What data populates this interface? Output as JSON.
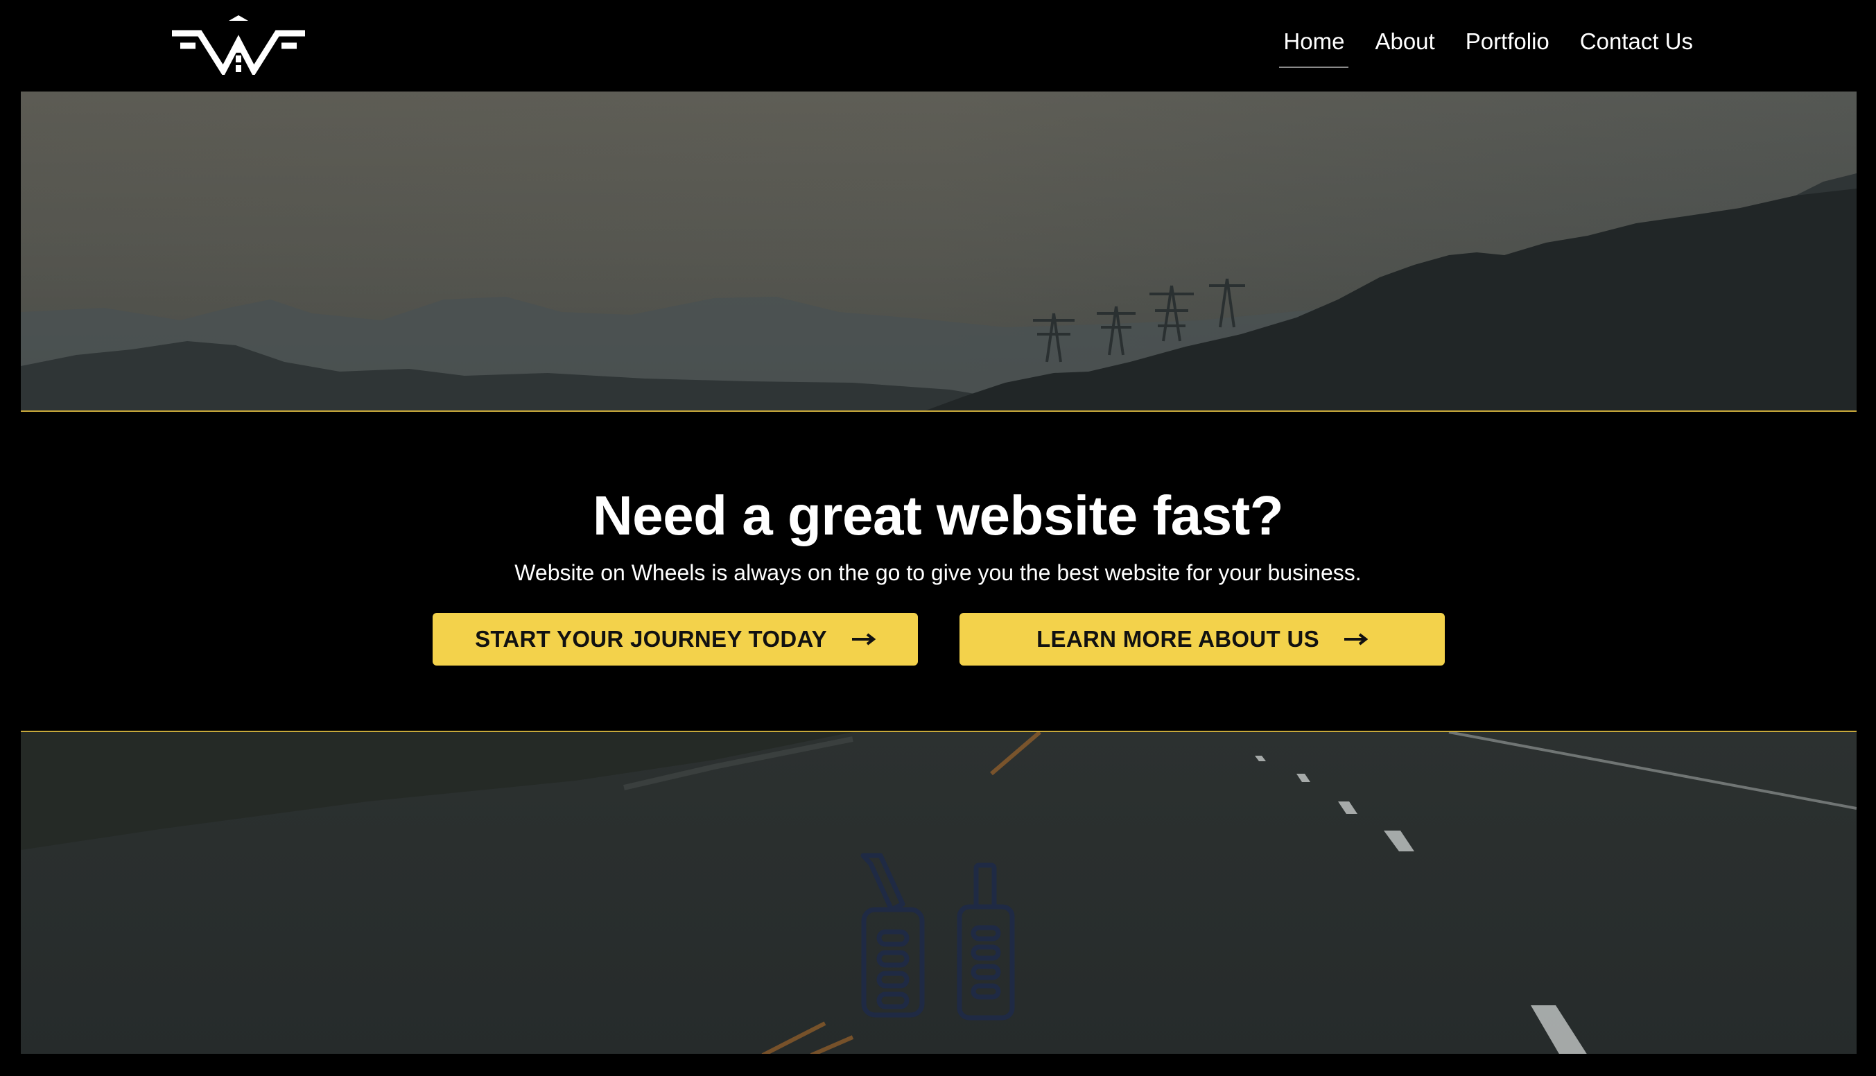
{
  "nav": {
    "items": [
      {
        "label": "Home",
        "active": true
      },
      {
        "label": "About",
        "active": false
      },
      {
        "label": "Portfolio",
        "active": false
      },
      {
        "label": "Contact Us",
        "active": false
      }
    ]
  },
  "hero": {
    "title": "Need a great website fast?",
    "subtitle": "Website on Wheels is always on the go to give you the best website for your business.",
    "primary_button": "START YOUR JOURNEY TODAY",
    "secondary_button": "LEARN MORE ABOUT US"
  },
  "colors": {
    "accent": "#f3d24b",
    "divider": "#c8a93a",
    "background": "#000000",
    "pedal_icon": "#1f2a44"
  },
  "icons": {
    "logo": "wow-logo",
    "button_arrow": "arrow-right-icon",
    "pedals": "car-pedals-icon"
  }
}
